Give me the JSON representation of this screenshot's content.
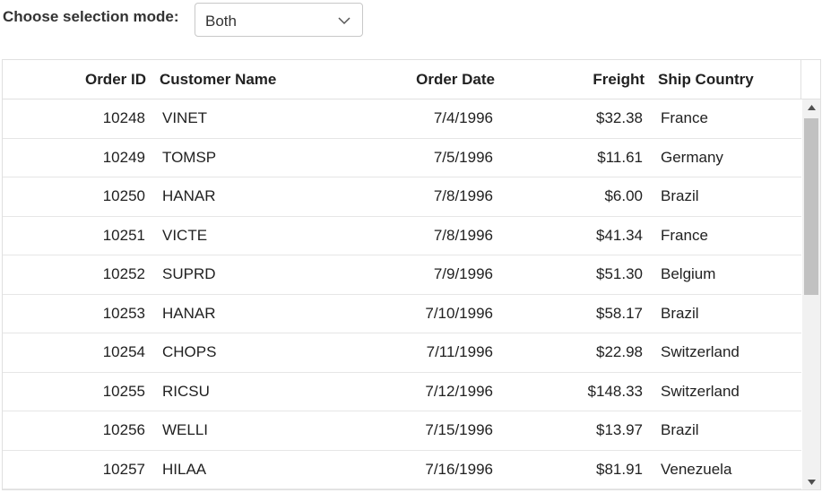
{
  "toolbar": {
    "mode_label": "Choose selection mode:",
    "mode_value": "Both",
    "chevron_icon": "chevron-down-icon"
  },
  "grid": {
    "columns": [
      "Order ID",
      "Customer Name",
      "Order Date",
      "Freight",
      "Ship Country"
    ],
    "rows": [
      {
        "order_id": "10248",
        "customer": "VINET",
        "date": "7/4/1996",
        "freight": "$32.38",
        "country": "France"
      },
      {
        "order_id": "10249",
        "customer": "TOMSP",
        "date": "7/5/1996",
        "freight": "$11.61",
        "country": "Germany"
      },
      {
        "order_id": "10250",
        "customer": "HANAR",
        "date": "7/8/1996",
        "freight": "$6.00",
        "country": "Brazil"
      },
      {
        "order_id": "10251",
        "customer": "VICTE",
        "date": "7/8/1996",
        "freight": "$41.34",
        "country": "France"
      },
      {
        "order_id": "10252",
        "customer": "SUPRD",
        "date": "7/9/1996",
        "freight": "$51.30",
        "country": "Belgium"
      },
      {
        "order_id": "10253",
        "customer": "HANAR",
        "date": "7/10/1996",
        "freight": "$58.17",
        "country": "Brazil"
      },
      {
        "order_id": "10254",
        "customer": "CHOPS",
        "date": "7/11/1996",
        "freight": "$22.98",
        "country": "Switzerland"
      },
      {
        "order_id": "10255",
        "customer": "RICSU",
        "date": "7/12/1996",
        "freight": "$148.33",
        "country": "Switzerland"
      },
      {
        "order_id": "10256",
        "customer": "WELLI",
        "date": "7/15/1996",
        "freight": "$13.97",
        "country": "Brazil"
      },
      {
        "order_id": "10257",
        "customer": "HILAA",
        "date": "7/16/1996",
        "freight": "$81.91",
        "country": "Venezuela"
      }
    ],
    "scrollbar": {
      "up_icon": "scroll-up-arrow-icon",
      "down_icon": "scroll-down-arrow-icon"
    }
  }
}
